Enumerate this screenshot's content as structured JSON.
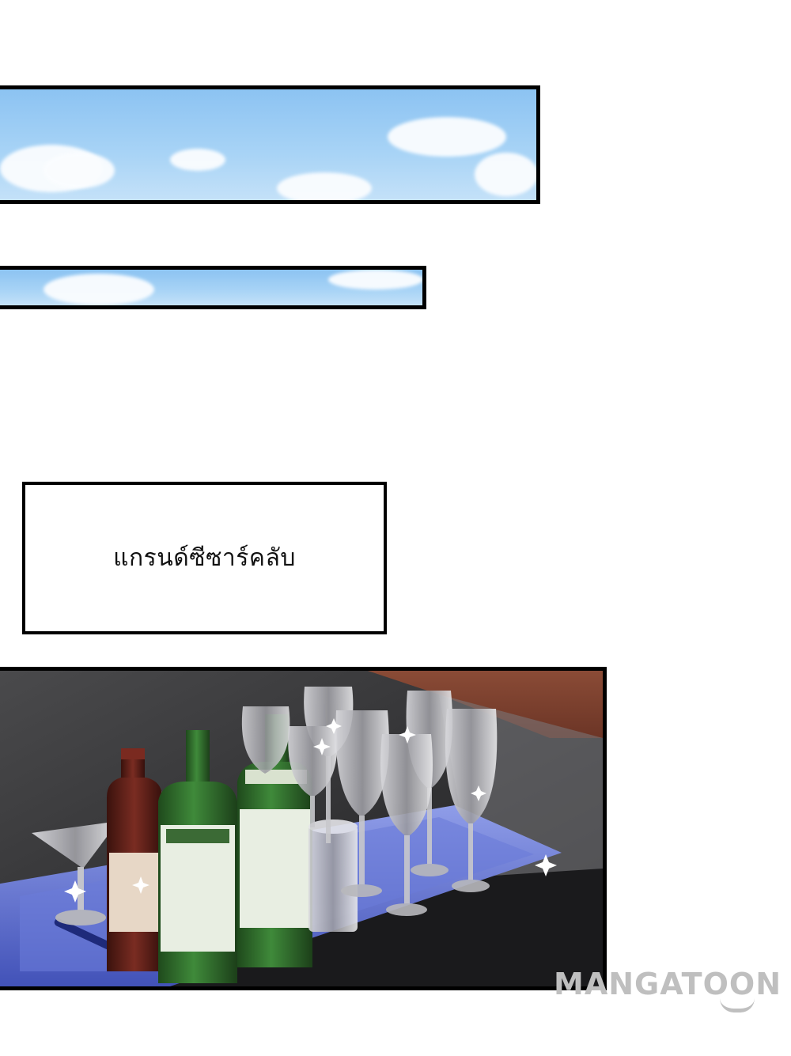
{
  "caption": {
    "text": "แกรนด์ซีซาร์คลับ"
  },
  "watermark": {
    "text": "MANGATOON"
  },
  "colors": {
    "sky": "#a9d4f6",
    "tray": "#5c6fd0",
    "bottle_green": "#2f6b2c",
    "bottle_brown": "#5a1f18",
    "panel_border": "#000000",
    "watermark": "#bfbfbf"
  }
}
